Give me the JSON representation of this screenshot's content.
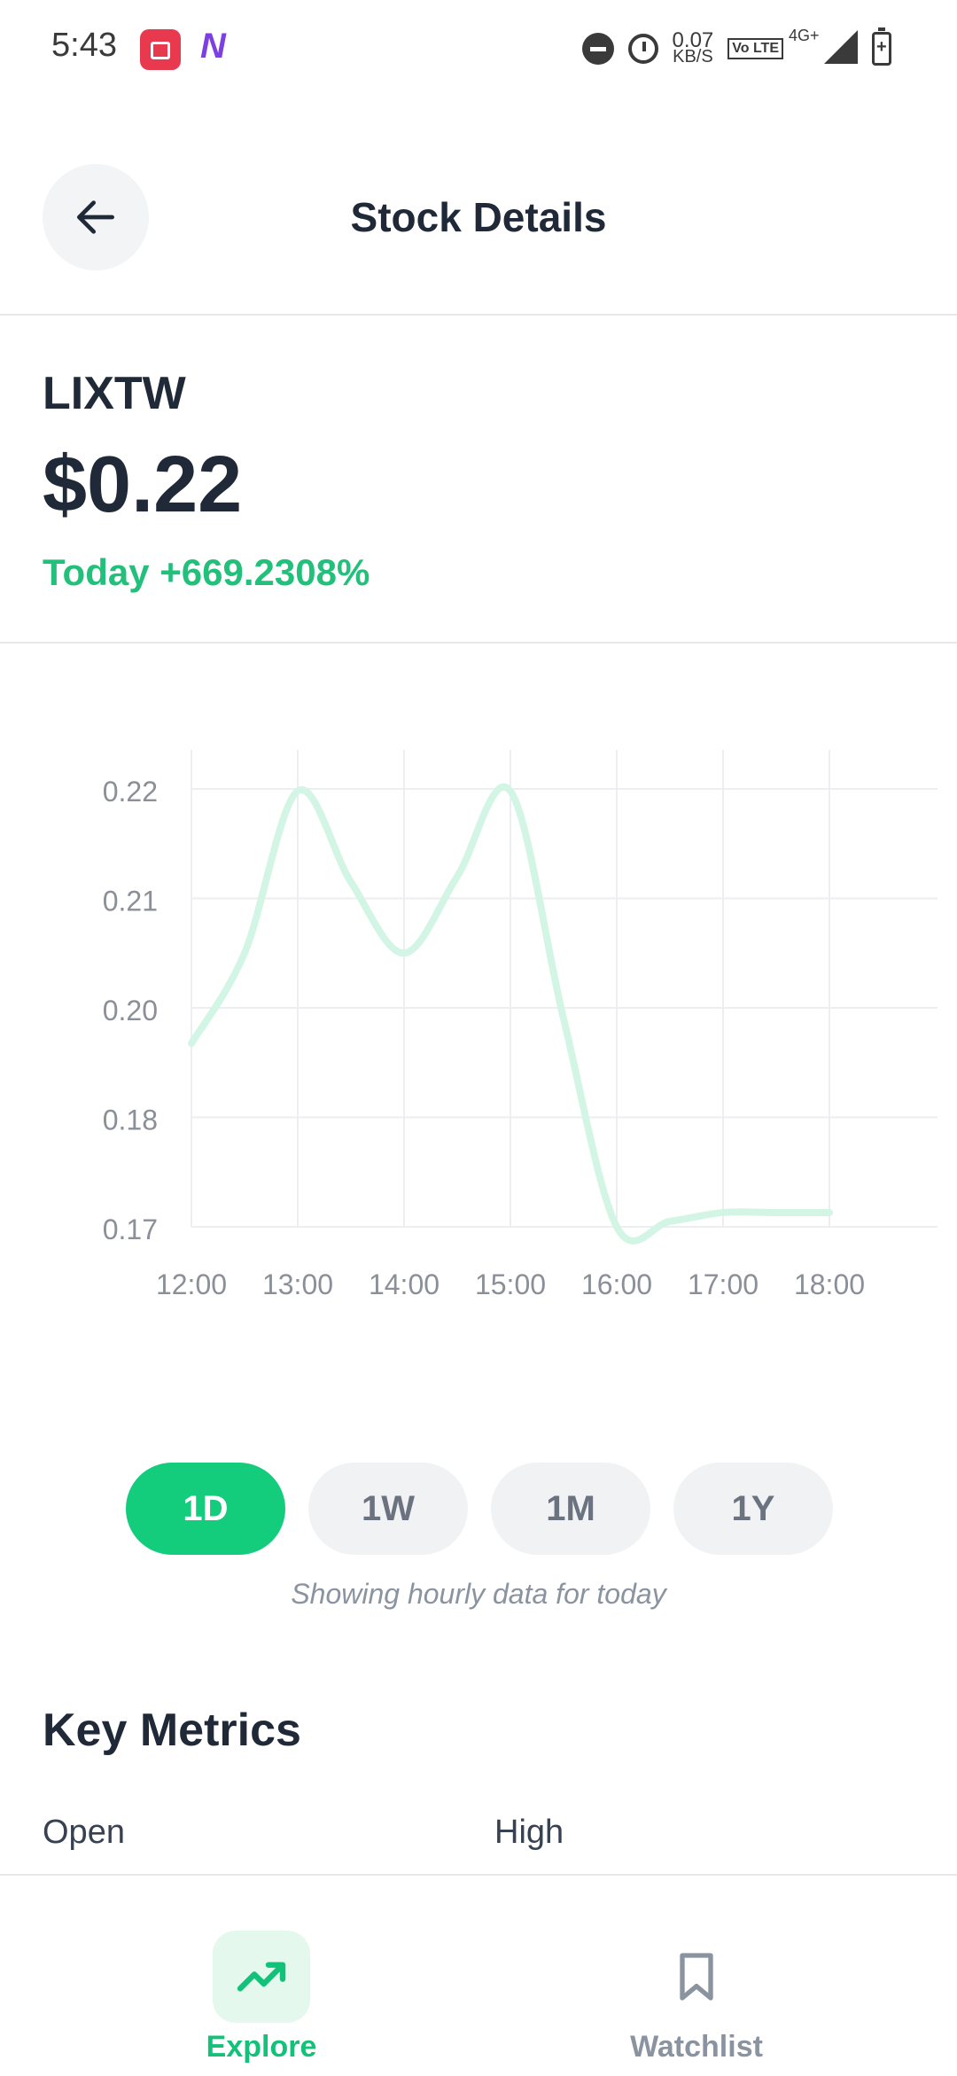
{
  "status_bar": {
    "time": "5:43",
    "net_speed_value": "0.07",
    "net_speed_unit": "KB/S",
    "network_type": "4G+",
    "volte": "Vo LTE"
  },
  "header": {
    "title": "Stock Details",
    "back_icon": "arrow-left-icon"
  },
  "stock": {
    "ticker": "LIXTW",
    "price": "$0.22",
    "change": "Today +669.2308%"
  },
  "chart_data": {
    "type": "line",
    "x": [
      "12:00",
      "12:30",
      "13:00",
      "13:30",
      "14:00",
      "14:30",
      "15:00",
      "15:30",
      "16:00",
      "16:30",
      "17:00",
      "17:30",
      "18:00"
    ],
    "y": [
      0.1935,
      0.205,
      0.2198,
      0.2115,
      0.205,
      0.212,
      0.2198,
      0.198,
      0.17,
      0.1705,
      0.1713,
      0.1713,
      0.1713
    ],
    "ytick_labels": [
      "0.22",
      "0.21",
      "0.20",
      "0.18",
      "0.17"
    ],
    "xtick_labels": [
      "12:00",
      "13:00",
      "14:00",
      "15:00",
      "16:00",
      "17:00",
      "18:00"
    ],
    "ylim": [
      0.17,
      0.222
    ],
    "grid": true,
    "line_color": "#d3f5e5"
  },
  "ranges": {
    "items": [
      {
        "label": "1D",
        "active": true
      },
      {
        "label": "1W",
        "active": false
      },
      {
        "label": "1M",
        "active": false
      },
      {
        "label": "1Y",
        "active": false
      }
    ],
    "note": "Showing hourly data for today"
  },
  "metrics": {
    "title": "Key Metrics",
    "open_label": "Open",
    "high_label": "High"
  },
  "nav": {
    "explore_label": "Explore",
    "explore_icon": "trending-up-icon",
    "watchlist_label": "Watchlist",
    "watchlist_icon": "bookmark-icon",
    "accent": "#13c27a"
  }
}
